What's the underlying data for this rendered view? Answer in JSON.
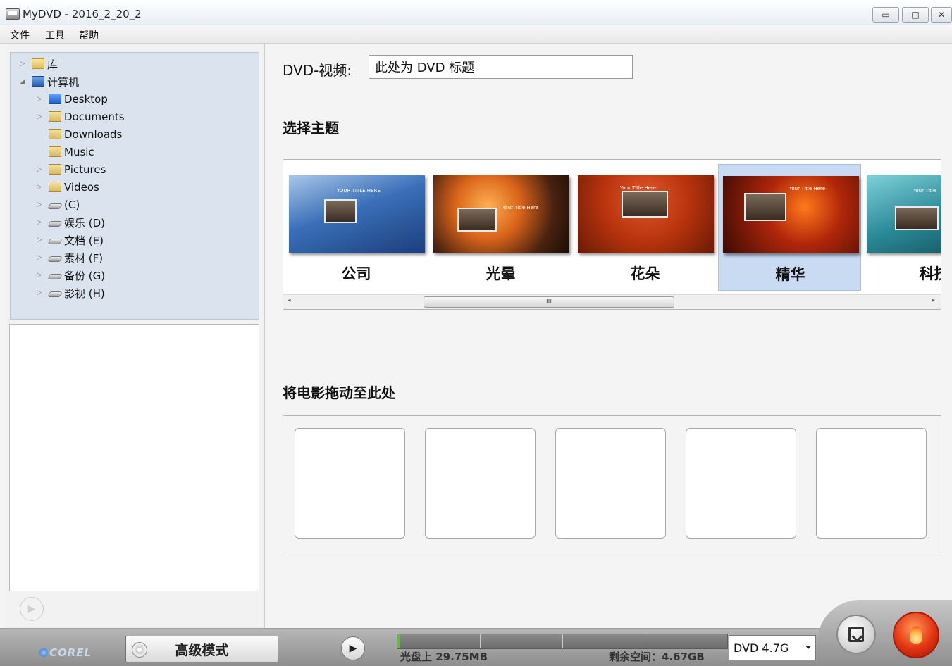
{
  "window": {
    "title": "MyDVD - 2016_2_20_2",
    "minimize_glyph": "▭",
    "maximize_glyph": "□",
    "close_glyph": "✕"
  },
  "menu": [
    "文件",
    "工具",
    "帮助"
  ],
  "tree": [
    {
      "label": "库",
      "icon": "library-folder-icon",
      "expander": "▷",
      "level": 0
    },
    {
      "label": "计算机",
      "icon": "computer-icon",
      "expander": "◢",
      "level": 0
    },
    {
      "label": "Desktop",
      "icon": "desktop-icon",
      "expander": "▷",
      "level": 1
    },
    {
      "label": "Documents",
      "icon": "documents-icon",
      "expander": "▷",
      "level": 1
    },
    {
      "label": "Downloads",
      "icon": "downloads-icon",
      "expander": "",
      "level": 1
    },
    {
      "label": "Music",
      "icon": "music-icon",
      "expander": "",
      "level": 1
    },
    {
      "label": "Pictures",
      "icon": "pictures-icon",
      "expander": "▷",
      "level": 1
    },
    {
      "label": "Videos",
      "icon": "videos-icon",
      "expander": "▷",
      "level": 1
    },
    {
      "label": " (C)",
      "icon": "drive-icon",
      "expander": "▷",
      "level": 1
    },
    {
      "label": "娱乐 (D)",
      "icon": "drive-icon",
      "expander": "▷",
      "level": 1
    },
    {
      "label": "文档 (E)",
      "icon": "drive-icon",
      "expander": "▷",
      "level": 1
    },
    {
      "label": "素材 (F)",
      "icon": "drive-icon",
      "expander": "▷",
      "level": 1
    },
    {
      "label": "备份 (G)",
      "icon": "drive-icon",
      "expander": "▷",
      "level": 1
    },
    {
      "label": "影视 (H)",
      "icon": "drive-icon",
      "expander": "▷",
      "level": 1
    }
  ],
  "preview": {
    "play_glyph": "▶"
  },
  "dvd": {
    "label": "DVD-视频:",
    "title_value": "此处为 DVD 标题"
  },
  "themes_section": {
    "title": "选择主题"
  },
  "themes": [
    {
      "name": "公司",
      "caption": "YOUR TITLE HERE",
      "selected": false
    },
    {
      "name": "光晕",
      "caption": "Your Title Here",
      "selected": false
    },
    {
      "name": "花朵",
      "caption": "Your Title Here",
      "selected": false
    },
    {
      "name": "精华",
      "caption": "Your Title Here",
      "selected": true
    },
    {
      "name": "科技",
      "caption": "Your Title",
      "selected": false
    }
  ],
  "scrollbar": {
    "left_glyph": "◂",
    "right_glyph": "▸",
    "grip": "III"
  },
  "drop_section": {
    "title": "将电影拖动至此处",
    "slot_count": 5
  },
  "bottom": {
    "brand": "COREL",
    "advanced_label": "高级模式",
    "play_glyph": "▶",
    "used_label": "光盘上 29.75MB",
    "free_label": "剩余空间：4.67GB",
    "used_fraction": 0.0064,
    "disc_type": "DVD 4.7G"
  }
}
